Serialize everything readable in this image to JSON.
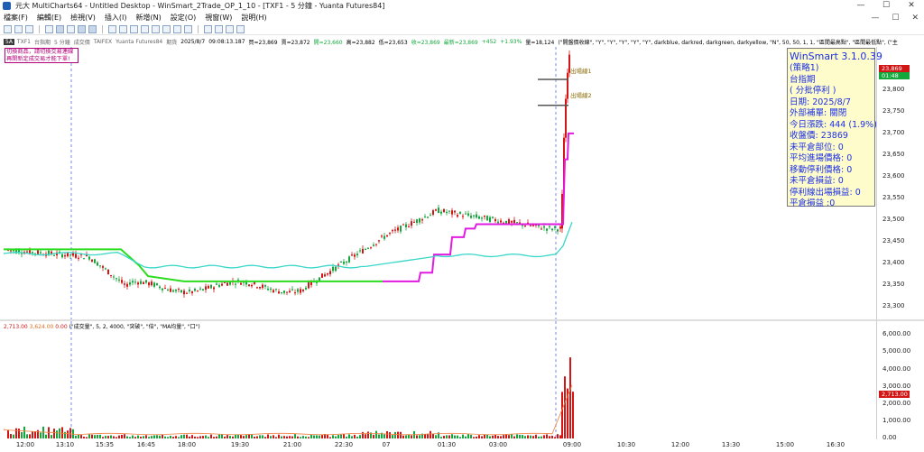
{
  "window": {
    "title": "元大 MultiCharts64 - Untitled Desktop - WinSmart_2Trade_OP_1_10 - [TXF1 - 5 分鐘 - Yuanta Futures84]",
    "controls": [
      "—",
      "☐",
      "✕"
    ]
  },
  "menu": {
    "items": [
      "檔案(F)",
      "編輯(E)",
      "檢視(V)",
      "插入(I)",
      "新增(N)",
      "設定(O)",
      "視窗(W)",
      "說明(H)"
    ]
  },
  "chart_bar": {
    "symbol_chip": "5A",
    "symbol": "TXF1",
    "name": "台指期",
    "interval": "5 分鐘",
    "volume_tag": "成交價",
    "exchange": "TAIFEX",
    "feed": "Yuanta Futures84",
    "date_label": "期貨",
    "date": "2025/8/7",
    "time": "09:08:13.187",
    "buy": "買=23,869",
    "sell": "賣=23,872",
    "open": "開=23,660",
    "high": "高=23,882",
    "low": "低=23,653",
    "prev": "收=23,869",
    "last": "最新=23,869",
    "change": "+452",
    "pct": "+1.93%",
    "vol": "量=18,124",
    "study_params": "(\"開盤價收線\", \"Y\", \"Y\", \"Y\", \"Y\", \"Y\", darkblue, darkred, darkgreen, darkyellow, \"N\", 50, 50, 1, 1, \"區間最高點\", \"區間最低點\", (\"主"
  },
  "notice": {
    "lines": [
      "切換商品，請切換交易連線",
      "再開新定成交易才能下單!"
    ]
  },
  "info_panel": {
    "lines": [
      "WinSmart 3.1.0.39",
      "(策略1)",
      "台指期",
      "( 分批停利 )",
      "日期: 2025/8/7",
      "外部補單: 關閉",
      "今日漲跌: 444 (1.9%)",
      "收盤價: 23869",
      "未平倉部位: 0",
      "平均進場價格: 0",
      "移動停利價格: 0",
      "未平倉損益: 0",
      "停利線出場損益: 0",
      "平倉損益 :0"
    ]
  },
  "markers": {
    "m1": "出場線1",
    "m2": "出場線2"
  },
  "price_axis": {
    "ticks": [
      23850,
      23800,
      23750,
      23700,
      23650,
      23600,
      23550,
      23500,
      23450,
      23400,
      23350,
      23300
    ],
    "tick_labels": [
      "23,850",
      "23,800",
      "23,750",
      "23,700",
      "23,650",
      "23,600",
      "23,550",
      "23,500",
      "23,450",
      "23,400",
      "23,350",
      "23,300"
    ],
    "last_price": "23,869",
    "last_price_color": "#d21515",
    "last_time": "01:48",
    "last_time_color": "#14a83c"
  },
  "vol_header": {
    "left1": "2,713.00",
    "left2": "3,624.00",
    "left3": "0.00",
    "params": "(\"成交量\", 5, 2, 4000, \"突破\", \"倍\", \"MA均量\", \"口\")"
  },
  "vol_axis": {
    "ticks": [
      6000,
      5000,
      4000,
      3000,
      2000,
      1000,
      0
    ],
    "tick_labels": [
      "6,000.00",
      "5,000.00",
      "4,000.00",
      "3,000.00",
      "2,000.00",
      "1,000.00",
      "0.00"
    ],
    "last_vol": "2,713.00",
    "last_vol_color": "#d21515"
  },
  "time_axis": {
    "labels": [
      "12:00",
      "13:10",
      "15:35",
      "16:45",
      "18:00",
      "19:30",
      "21:00",
      "22:30",
      "07",
      "01:30",
      "03:00",
      "09:00",
      "10:30",
      "12:00",
      "13:30",
      "15:00",
      "16:30"
    ]
  },
  "colors": {
    "up": "#d21515",
    "down": "#14a83c",
    "green_line": "#2bdc1e",
    "cyan_line": "#38d7c8",
    "magenta_line": "#e21be0",
    "info_text": "#1a2fe6",
    "info_bg": "#fffccc"
  }
}
